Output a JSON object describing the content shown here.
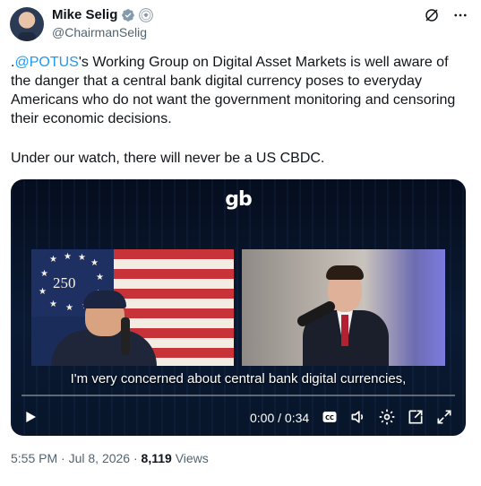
{
  "author": {
    "display_name": "Mike Selig",
    "handle": "@ChairmanSelig"
  },
  "tweet": {
    "text_prefix": ".",
    "mention": "@POTUS",
    "text_body": "'s Working Group on Digital Asset Markets is well aware of the danger that a central bank digital currency poses to everyday Americans who do not want the government monitoring and censoring their economic decisions.",
    "paragraph_2": "Under our watch, there will never be a US CBDC."
  },
  "video": {
    "logo": "gb",
    "flag_number": "250",
    "caption": "I'm very concerned about central bank digital currencies,",
    "time": "0:00 / 0:34",
    "progress": 0
  },
  "meta": {
    "time": "5:55 PM",
    "sep1": " · ",
    "date": "Jul 8, 2026",
    "sep2": " · ",
    "views_count": "8,119",
    "views_label": " Views"
  },
  "colors": {
    "link": "#1d9bf0",
    "verified": "#829aab",
    "text": "#0f1419",
    "secondary": "#536471"
  },
  "icons": [
    "verified-badge-icon",
    "government-badge-icon",
    "grok-icon",
    "more-icon",
    "play-icon",
    "captions-icon",
    "volume-icon",
    "settings-icon",
    "pip-icon",
    "fullscreen-icon"
  ]
}
